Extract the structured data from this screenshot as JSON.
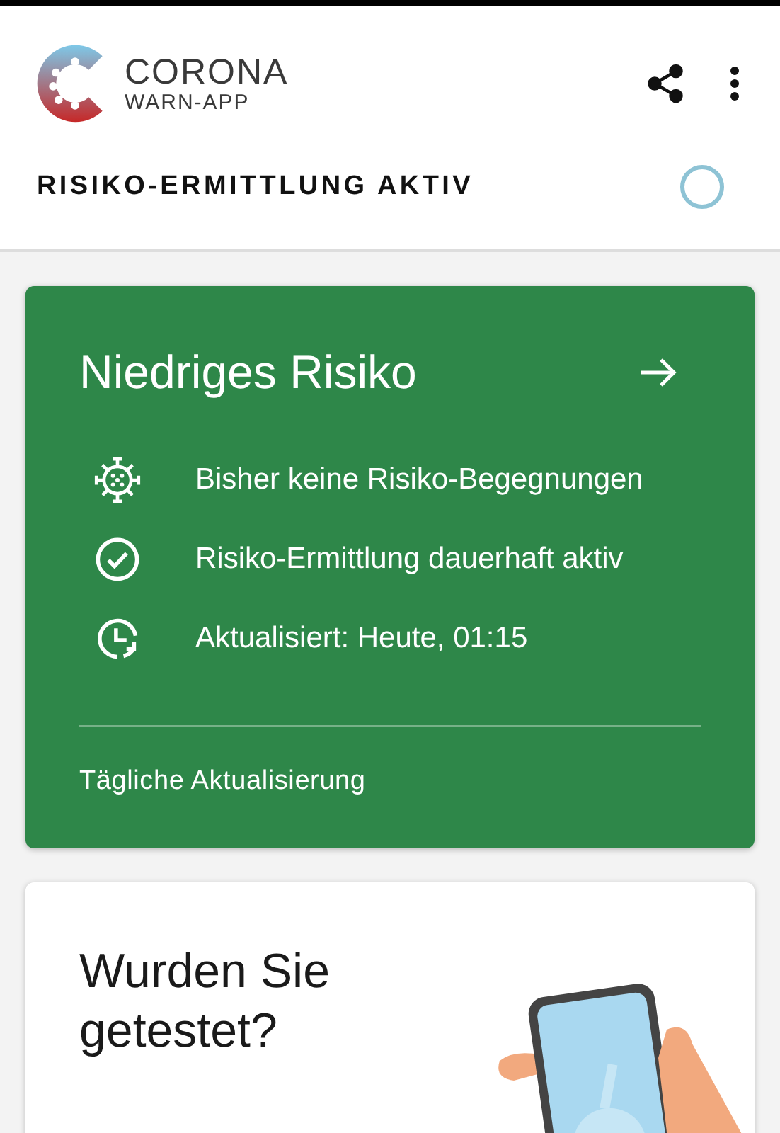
{
  "app_bar": {
    "logo_title": "CORONA",
    "logo_subtitle": "WARN-APP"
  },
  "tracing_status": {
    "label": "RISIKO-ERMITTLUNG AKTIV"
  },
  "risk_card": {
    "title": "Niedriges Risiko",
    "color": "#2e8749",
    "items": [
      {
        "kind": "virus",
        "text": "Bisher keine Risiko-Begegnungen"
      },
      {
        "kind": "check",
        "text": "Risiko-Ermittlung dauerhaft aktiv"
      },
      {
        "kind": "clock",
        "text": "Aktualisiert: Heute, 01:15"
      }
    ],
    "footer": "Tägliche Aktualisierung"
  },
  "test_card": {
    "title": "Wurden Sie getestet?"
  }
}
